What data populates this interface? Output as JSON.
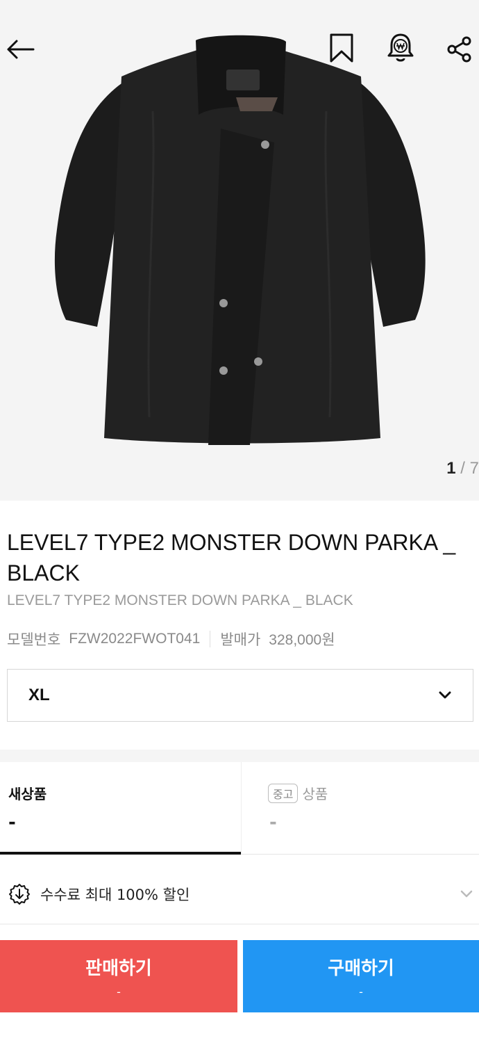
{
  "gallery": {
    "current": "1",
    "separator": " / ",
    "total": "7"
  },
  "product": {
    "title": "LEVEL7 TYPE2 MONSTER DOWN PARKA _ BLACK",
    "subtitle": "LEVEL7 TYPE2 MONSTER DOWN PARKA _ BLACK",
    "model_label": "모델번호",
    "model_number": "FZW2022FWOT041",
    "release_label": "발매가",
    "release_price": "328,000원"
  },
  "size_select": {
    "value": "XL"
  },
  "tabs": {
    "new": {
      "label": "새상품",
      "price": "-"
    },
    "used": {
      "badge": "중고",
      "label": "상품",
      "price": "-"
    }
  },
  "promo": {
    "text": "수수료 최대 100% 할인"
  },
  "actions": {
    "sell": {
      "label": "판매하기",
      "price": "-"
    },
    "buy": {
      "label": "구매하기",
      "price": "-"
    }
  },
  "colors": {
    "sell": "#ef5350",
    "buy": "#2196f3",
    "jacket": "#1c1c1c"
  },
  "icons": [
    "back-arrow-icon",
    "bookmark-icon",
    "price-alert-bell-icon",
    "share-icon",
    "chevron-down-icon",
    "discount-badge-icon"
  ]
}
